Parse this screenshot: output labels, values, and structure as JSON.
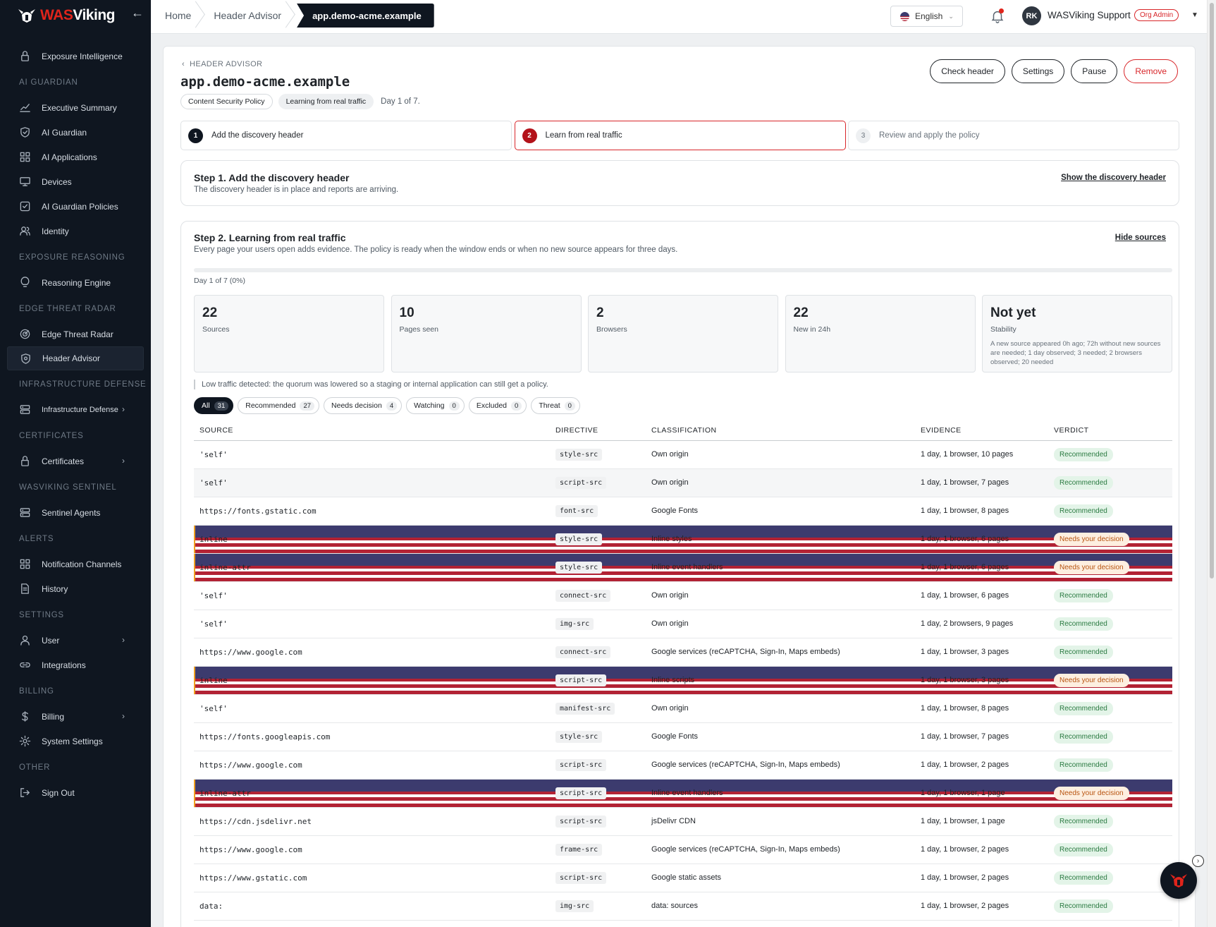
{
  "brand": {
    "name_part1": "WAS",
    "name_part2": "Viking"
  },
  "sidebar": {
    "top_items": [
      {
        "label": "Exposure Intelligence",
        "icon": "lock-icon"
      }
    ],
    "sections": [
      {
        "title": "AI GUARDIAN",
        "items": [
          {
            "label": "Executive Summary",
            "icon": "chart-line-icon"
          },
          {
            "label": "AI Guardian",
            "icon": "shield-check-icon"
          },
          {
            "label": "AI Applications",
            "icon": "grid-icon"
          },
          {
            "label": "Devices",
            "icon": "monitor-icon"
          },
          {
            "label": "AI Guardian Policies",
            "icon": "checkbox-icon"
          },
          {
            "label": "Identity",
            "icon": "users-icon"
          }
        ]
      },
      {
        "title": "EXPOSURE REASONING",
        "items": [
          {
            "label": "Reasoning Engine",
            "icon": "lightbulb-icon"
          }
        ]
      },
      {
        "title": "EDGE THREAT RADAR",
        "items": [
          {
            "label": "Edge Threat Radar",
            "icon": "radar-icon"
          },
          {
            "label": "Header Advisor",
            "icon": "shield-icon"
          }
        ]
      },
      {
        "title": "INFRASTRUCTURE DEFENSE",
        "items": [
          {
            "label": "Infrastructure Defense",
            "icon": "server-icon"
          }
        ]
      },
      {
        "title": "CERTIFICATES",
        "items": [
          {
            "label": "Certificates",
            "icon": "lock-icon"
          }
        ]
      },
      {
        "title": "WASVIKING SENTINEL",
        "items": [
          {
            "label": "Sentinel Agents",
            "icon": "server-icon"
          }
        ]
      },
      {
        "title": "ALERTS",
        "items": [
          {
            "label": "Notification Channels",
            "icon": "grid-icon"
          },
          {
            "label": "History",
            "icon": "document-icon"
          }
        ]
      },
      {
        "title": "SETTINGS",
        "items": [
          {
            "label": "User",
            "icon": "user-icon"
          },
          {
            "label": "Integrations",
            "icon": "link-icon"
          }
        ]
      },
      {
        "title": "BILLING",
        "items": [
          {
            "label": "Billing",
            "icon": "dollar-icon"
          },
          {
            "label": "System Settings",
            "icon": "gear-icon"
          }
        ]
      },
      {
        "title": "OTHER",
        "items": [
          {
            "label": "Sign Out",
            "icon": "sign-out-icon"
          }
        ]
      }
    ]
  },
  "topbar": {
    "breadcrumbs": [
      "Home",
      "Header Advisor",
      "app.demo-acme.example"
    ],
    "language": "English",
    "user_initials": "RK",
    "user_name": "WASViking Support",
    "role": "Org Admin"
  },
  "page": {
    "back_label": "HEADER ADVISOR",
    "title": "app.demo-acme.example",
    "chip_policy": "Content Security Policy",
    "chip_status": "Learning from real traffic",
    "day_text": "Day 1 of 7.",
    "actions": {
      "check": "Check header",
      "settings": "Settings",
      "pause": "Pause",
      "remove": "Remove"
    },
    "steps": [
      {
        "num": "1",
        "label": "Add the discovery header"
      },
      {
        "num": "2",
        "label": "Learn from real traffic"
      },
      {
        "num": "3",
        "label": "Review and apply the policy"
      }
    ],
    "step1": {
      "title": "Step 1. Add the discovery header",
      "subtitle": "The discovery header is in place and reports are arriving.",
      "link": "Show the discovery header"
    },
    "step2": {
      "title": "Step 2. Learning from real traffic",
      "subtitle": "Every page your users open adds evidence. The policy is ready when the window ends or when no new source appears for three days.",
      "link": "Hide sources",
      "progress_fraction": 0,
      "progress_label": "Day 1 of 7 (0%)",
      "stats": [
        {
          "value": "22",
          "label": "Sources"
        },
        {
          "value": "10",
          "label": "Pages seen"
        },
        {
          "value": "2",
          "label": "Browsers"
        },
        {
          "value": "22",
          "label": "New in 24h"
        },
        {
          "value": "Not yet",
          "label": "Stability",
          "note": "A new source appeared 0h ago; 72h without new sources are needed; 1 day observed; 3 needed; 2 browsers observed; 20 needed"
        }
      ],
      "notice": "Low traffic detected: the quorum was lowered so a staging or internal application can still get a policy.",
      "filters": [
        {
          "label": "All",
          "count": "31"
        },
        {
          "label": "Recommended",
          "count": "27"
        },
        {
          "label": "Needs decision",
          "count": "4"
        },
        {
          "label": "Watching",
          "count": "0"
        },
        {
          "label": "Excluded",
          "count": "0"
        },
        {
          "label": "Threat",
          "count": "0"
        }
      ],
      "columns": [
        "SOURCE",
        "DIRECTIVE",
        "CLASSIFICATION",
        "EVIDENCE",
        "VERDICT"
      ],
      "rows": [
        {
          "source": "'self'",
          "directive": "style-src",
          "classification": "Own origin",
          "evidence": "1 day, 1 browser, 10 pages",
          "verdict": "Recommended"
        },
        {
          "source": "'self'",
          "directive": "script-src",
          "classification": "Own origin",
          "evidence": "1 day, 1 browser, 7 pages",
          "verdict": "Recommended"
        },
        {
          "source": "https://fonts.gstatic.com",
          "directive": "font-src",
          "classification": "Google Fonts",
          "evidence": "1 day, 1 browser, 8 pages",
          "verdict": "Recommended"
        },
        {
          "source": "inline",
          "directive": "style-src",
          "classification": "Inline styles",
          "evidence": "1 day, 1 browser, 6 pages",
          "verdict": "Needs your decision"
        },
        {
          "source": "inline-attr",
          "directive": "style-src",
          "classification": "Inline event handlers",
          "evidence": "1 day, 1 browser, 6 pages",
          "verdict": "Needs your decision"
        },
        {
          "source": "'self'",
          "directive": "connect-src",
          "classification": "Own origin",
          "evidence": "1 day, 1 browser, 6 pages",
          "verdict": "Recommended"
        },
        {
          "source": "'self'",
          "directive": "img-src",
          "classification": "Own origin",
          "evidence": "1 day, 2 browsers, 9 pages",
          "verdict": "Recommended"
        },
        {
          "source": "https://www.google.com",
          "directive": "connect-src",
          "classification": "Google services (reCAPTCHA, Sign-In, Maps embeds)",
          "evidence": "1 day, 1 browser, 3 pages",
          "verdict": "Recommended"
        },
        {
          "source": "inline",
          "directive": "script-src",
          "classification": "Inline scripts",
          "evidence": "1 day, 1 browser, 3 pages",
          "verdict": "Needs your decision"
        },
        {
          "source": "'self'",
          "directive": "manifest-src",
          "classification": "Own origin",
          "evidence": "1 day, 1 browser, 8 pages",
          "verdict": "Recommended"
        },
        {
          "source": "https://fonts.googleapis.com",
          "directive": "style-src",
          "classification": "Google Fonts",
          "evidence": "1 day, 1 browser, 7 pages",
          "verdict": "Recommended"
        },
        {
          "source": "https://www.google.com",
          "directive": "script-src",
          "classification": "Google services (reCAPTCHA, Sign-In, Maps embeds)",
          "evidence": "1 day, 1 browser, 2 pages",
          "verdict": "Recommended"
        },
        {
          "source": "inline-attr",
          "directive": "script-src",
          "classification": "Inline event handlers",
          "evidence": "1 day, 1 browser, 1 page",
          "verdict": "Needs your decision"
        },
        {
          "source": "https://cdn.jsdelivr.net",
          "directive": "script-src",
          "classification": "jsDelivr CDN",
          "evidence": "1 day, 1 browser, 1 page",
          "verdict": "Recommended"
        },
        {
          "source": "https://www.google.com",
          "directive": "frame-src",
          "classification": "Google services (reCAPTCHA, Sign-In, Maps embeds)",
          "evidence": "1 day, 1 browser, 2 pages",
          "verdict": "Recommended"
        },
        {
          "source": "https://www.gstatic.com",
          "directive": "script-src",
          "classification": "Google static assets",
          "evidence": "1 day, 1 browser, 2 pages",
          "verdict": "Recommended"
        },
        {
          "source": "data:",
          "directive": "img-src",
          "classification": "data: sources",
          "evidence": "1 day, 1 browser, 2 pages",
          "verdict": "Recommended"
        }
      ]
    }
  },
  "colors": {
    "accent_red": "#d8262a",
    "sidebar_bg": "#0f1620",
    "recommended": "#2a7a41",
    "needs_decision": "#b8530f"
  }
}
